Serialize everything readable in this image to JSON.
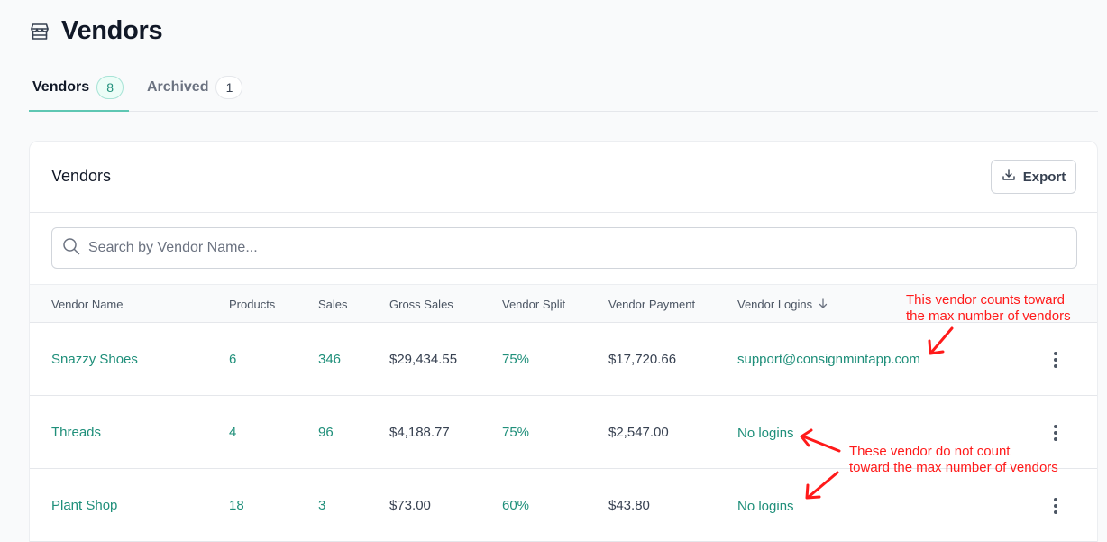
{
  "page": {
    "icon": "storefront-icon",
    "title": "Vendors"
  },
  "tabs": [
    {
      "label": "Vendors",
      "count": "8",
      "active": true
    },
    {
      "label": "Archived",
      "count": "1",
      "active": false
    }
  ],
  "card": {
    "title": "Vendors",
    "export_label": "Export",
    "export_icon": "download-icon"
  },
  "search": {
    "icon": "search-icon",
    "placeholder": "Search by Vendor Name...",
    "value": ""
  },
  "table": {
    "columns": [
      "Vendor Name",
      "Products",
      "Sales",
      "Gross Sales",
      "Vendor Split",
      "Vendor Payment",
      "Vendor Logins"
    ],
    "sort_column": "Vendor Logins",
    "sort_icon": "arrow-down-icon",
    "rows": [
      {
        "name": "Snazzy Shoes",
        "products": "6",
        "sales": "346",
        "gross": "$29,434.55",
        "split": "75%",
        "payment": "$17,720.66",
        "logins": "support@consignmintapp.com"
      },
      {
        "name": "Threads",
        "products": "4",
        "sales": "96",
        "gross": "$4,188.77",
        "split": "75%",
        "payment": "$2,547.00",
        "logins": "No logins"
      },
      {
        "name": "Plant Shop",
        "products": "18",
        "sales": "3",
        "gross": "$73.00",
        "split": "60%",
        "payment": "$43.80",
        "logins": "No logins"
      }
    ]
  },
  "annotations": {
    "counts_line1": "This vendor counts toward",
    "counts_line2": "the max number of vendors",
    "notcount_line1": "These vendor do not count",
    "notcount_line2": "toward the max number of vendors",
    "color": "#ff1a1a"
  },
  "colors": {
    "accent": "#1f8f7a",
    "tab_underline": "#5fc7b3"
  }
}
